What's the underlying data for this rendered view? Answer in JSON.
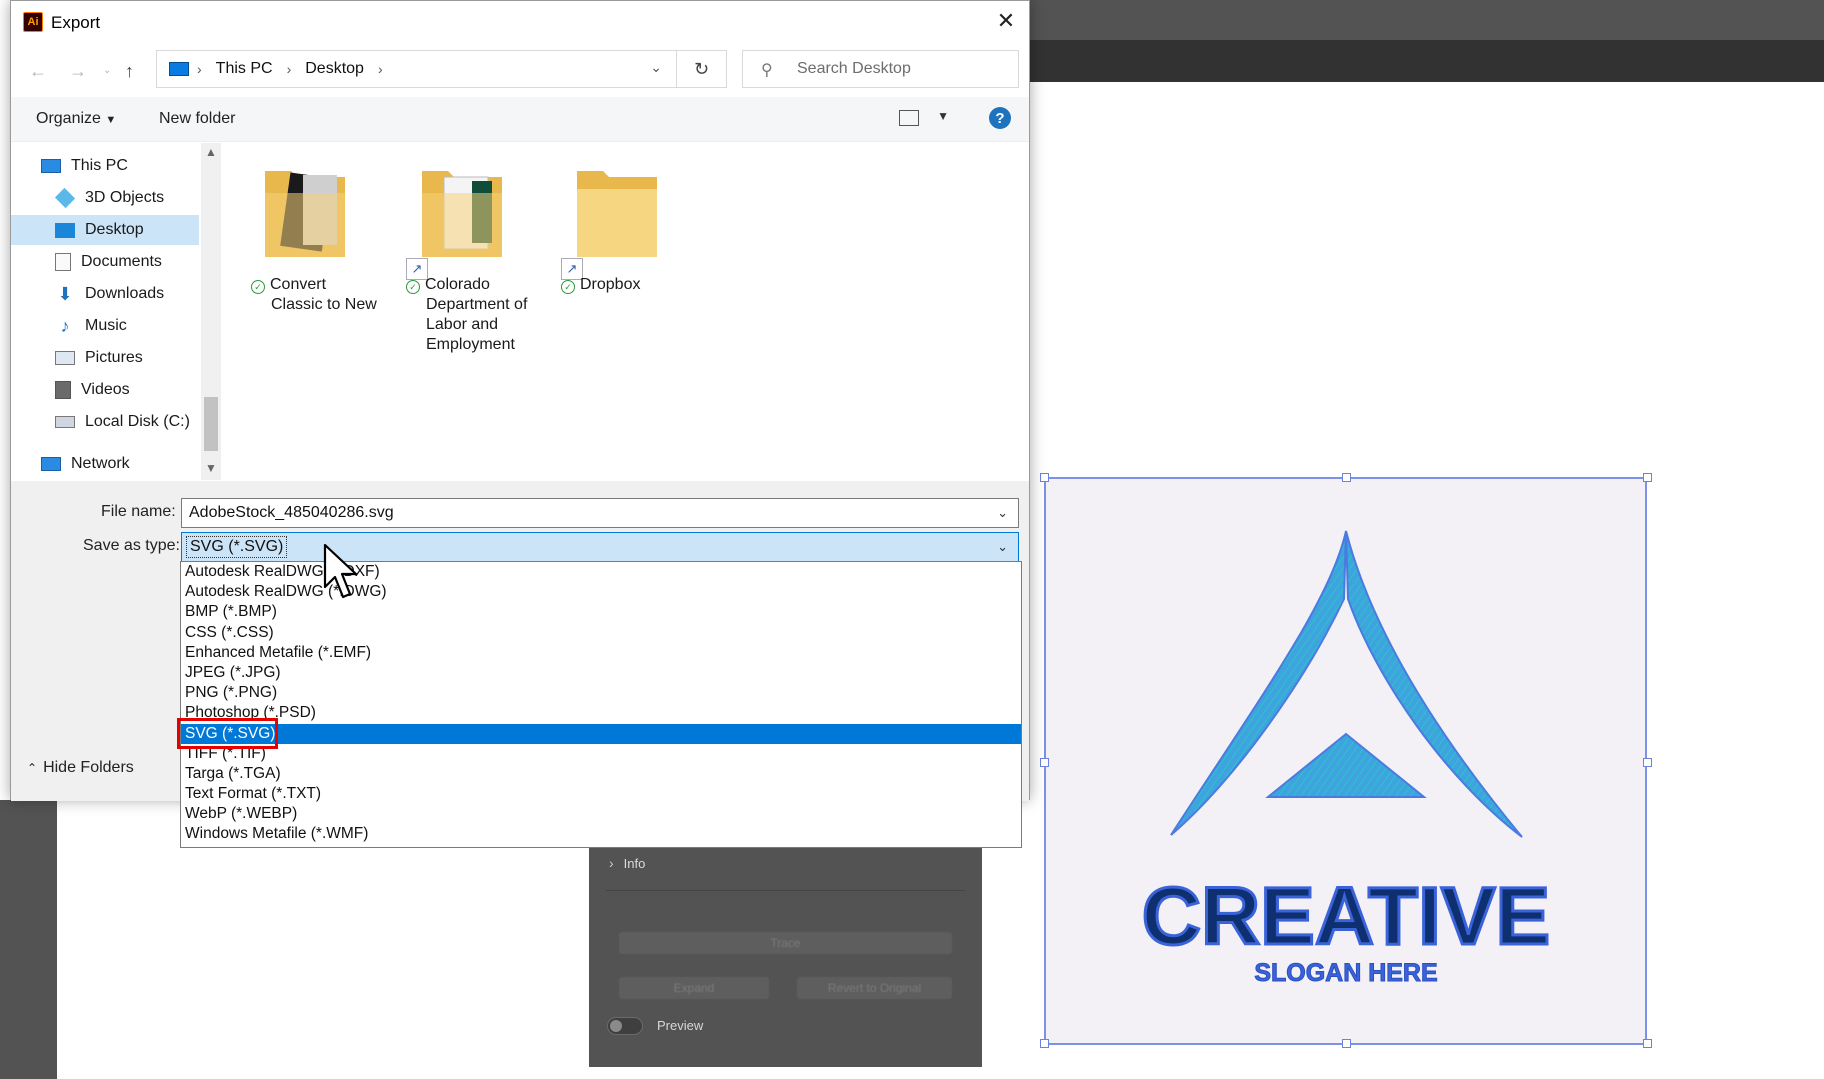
{
  "dialog": {
    "title": "Export",
    "app_icon": "Ai",
    "close": "✕",
    "breadcrumb": [
      "This PC",
      "Desktop"
    ],
    "search_placeholder": "Search Desktop",
    "toolbar": {
      "organize": "Organize",
      "new_folder": "New folder",
      "help": "?"
    },
    "nav": {
      "items": [
        {
          "label": "This PC",
          "icon": "pc-icon"
        },
        {
          "label": "3D Objects",
          "icon": "3d-objects-icon"
        },
        {
          "label": "Desktop",
          "icon": "desktop-icon",
          "selected": true
        },
        {
          "label": "Documents",
          "icon": "documents-icon"
        },
        {
          "label": "Downloads",
          "icon": "downloads-icon"
        },
        {
          "label": "Music",
          "icon": "music-icon"
        },
        {
          "label": "Pictures",
          "icon": "pictures-icon"
        },
        {
          "label": "Videos",
          "icon": "videos-icon"
        },
        {
          "label": "Local Disk (C:)",
          "icon": "disk-icon"
        },
        {
          "label": "Network",
          "icon": "network-icon"
        }
      ]
    },
    "files": [
      {
        "name": [
          "Convert",
          "Classic to New"
        ],
        "type": "folder"
      },
      {
        "name": [
          "Colorado",
          "Department of",
          "Labor and",
          "Employment"
        ],
        "type": "folder-shortcut"
      },
      {
        "name": [
          "Dropbox"
        ],
        "type": "folder-shortcut"
      }
    ],
    "file_name_label": "File name:",
    "file_name_value": "AdobeStock_485040286.svg",
    "save_type_label": "Save as type:",
    "save_type_value": "SVG (*.SVG)",
    "hide_folders": "Hide Folders",
    "type_options": [
      "Autodesk RealDWG (*.DXF)",
      "Autodesk RealDWG (*.DWG)",
      "BMP (*.BMP)",
      "CSS (*.CSS)",
      "Enhanced Metafile (*.EMF)",
      "JPEG (*.JPG)",
      "PNG (*.PNG)",
      "Photoshop (*.PSD)",
      "SVG (*.SVG)",
      "TIFF (*.TIF)",
      "Targa (*.TGA)",
      "Text Format (*.TXT)",
      "WebP (*.WEBP)",
      "Windows Metafile (*.WMF)"
    ],
    "selected_option_index": 8
  },
  "panel": {
    "info": "Info",
    "trace": "Trace",
    "expand": "Expand",
    "revert": "Revert to Original",
    "preview": "Preview"
  },
  "artwork": {
    "title": "CREATIVE",
    "slogan": "SLOGAN HERE",
    "colors": {
      "triangle": "#3fa6e0",
      "text": "#0e2f70",
      "text_outline": "#3b63d9",
      "frame": "#7a92e8"
    }
  }
}
